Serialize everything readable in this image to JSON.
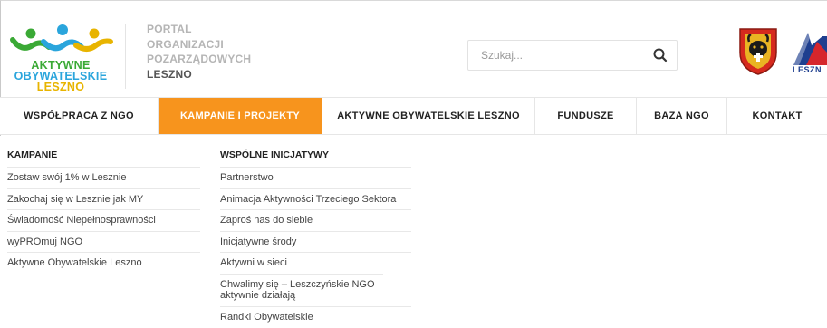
{
  "logo": {
    "line1": "AKTYWNE",
    "line2": "OBYWATELSKIE",
    "line3": "LESZNO",
    "colors": {
      "green": "#3aa935",
      "blue": "#2aa5dc",
      "yellow": "#e8b400"
    }
  },
  "portal": {
    "lines": [
      "PORTAL",
      "ORGANIZACJI",
      "POZARZĄDOWYCH"
    ],
    "city": "LESZNO"
  },
  "search": {
    "placeholder": "Szukaj...",
    "icon": "search-icon"
  },
  "emblems": {
    "coat_icon": "coat-of-arms-icon",
    "leszno_logo_text": "LESZN"
  },
  "nav": {
    "items": [
      {
        "label": "WSPÓŁPRACA Z NGO"
      },
      {
        "label": "KAMPANIE I PROJEKTY",
        "active": true
      },
      {
        "label": "AKTYWNE OBYWATELSKIE LESZNO"
      },
      {
        "label": "FUNDUSZE"
      },
      {
        "label": "BAZA NGO"
      },
      {
        "label": "KONTAKT"
      }
    ],
    "accent": "#f7941d"
  },
  "dropdown": {
    "kampanie": {
      "title": "KAMPANIE",
      "items": [
        "Zostaw swój 1% w Lesznie",
        "Zakochaj się w Lesznie jak MY",
        "Świadomość Niepełnosprawności",
        "wyPROmuj NGO",
        "Aktywne Obywatelskie Leszno"
      ]
    },
    "inicjatywy": {
      "title": "WSPÓLNE INICJATYWY",
      "items": [
        "Partnerstwo",
        "Animacja Aktywności Trzeciego Sektora",
        "Zaproś nas do siebie",
        "Inicjatywne środy",
        "Aktywni w sieci",
        "Chwalimy się – Leszczyńskie NGO aktywnie działają",
        "Randki Obywatelskie"
      ]
    }
  }
}
